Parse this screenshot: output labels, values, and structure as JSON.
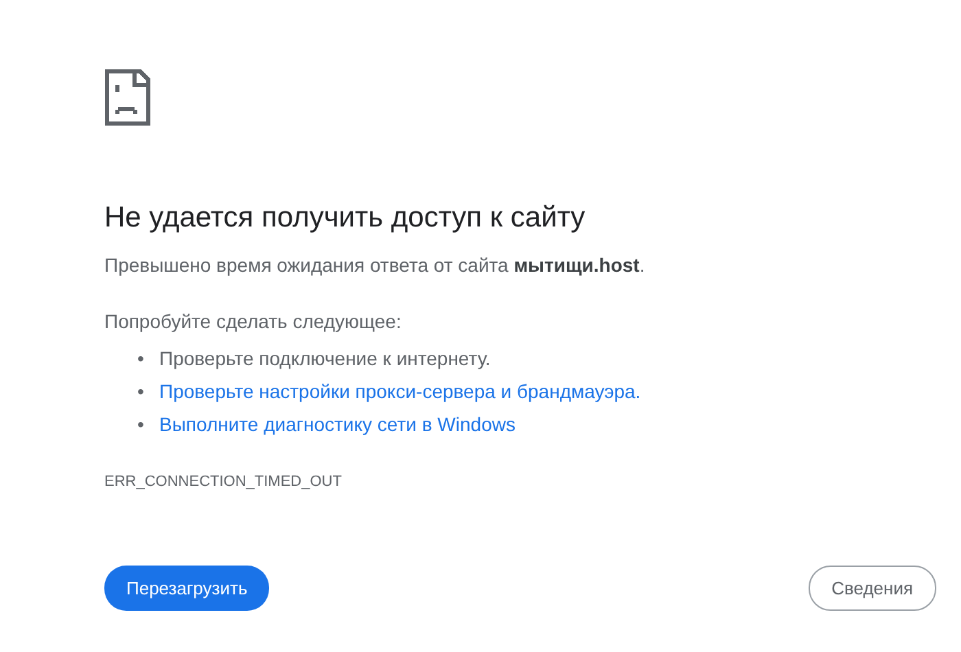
{
  "heading": "Не удается получить доступ к сайту",
  "message": "Превышено время ожидания ответа от сайта **мытищи.host**.",
  "suggestions_intro": "Попробуйте сделать следующее:",
  "suggestions": [
    {
      "kind": "text",
      "bullet": "•",
      "text": "Проверьте подключение к интернету."
    },
    {
      "kind": "link",
      "bullet": "•",
      "text": "Проверьте настройки прокси-сервера и брандмауэра."
    },
    {
      "kind": "link",
      "bullet": "•",
      "text": "Выполните диагностику сети в Windows"
    }
  ],
  "error_code": "ERR_CONNECTION_TIMED_OUT",
  "buttons": [
    {
      "kind": "primary",
      "label": "Перезагрузить"
    },
    {
      "kind": "secondary",
      "label": "Сведения"
    }
  ]
}
